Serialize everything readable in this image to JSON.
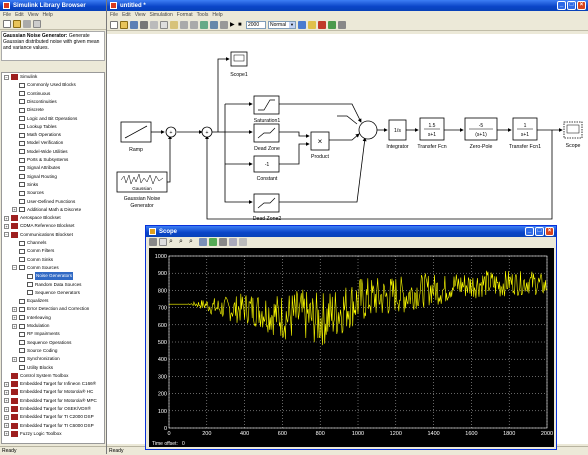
{
  "library": {
    "title": "Simulink Library Browser",
    "menu": [
      "File",
      "Edit",
      "View",
      "Help"
    ],
    "description_title": "Gaussian Noise Generator:",
    "description_text": "Generate Gaussian distributed noise with given mean and variance values.",
    "status": "Ready",
    "tree": [
      {
        "label": "Simulink",
        "level": 0,
        "kind": "lib",
        "exp": "−"
      },
      {
        "label": "Commonly Used Blocks",
        "level": 1,
        "kind": "block"
      },
      {
        "label": "Continuous",
        "level": 1,
        "kind": "block"
      },
      {
        "label": "Discontinuities",
        "level": 1,
        "kind": "block"
      },
      {
        "label": "Discrete",
        "level": 1,
        "kind": "block"
      },
      {
        "label": "Logic and Bit Operations",
        "level": 1,
        "kind": "block"
      },
      {
        "label": "Lookup Tables",
        "level": 1,
        "kind": "block"
      },
      {
        "label": "Math Operations",
        "level": 1,
        "kind": "block"
      },
      {
        "label": "Model Verification",
        "level": 1,
        "kind": "block"
      },
      {
        "label": "Model-Wide Utilities",
        "level": 1,
        "kind": "block"
      },
      {
        "label": "Ports & Subsystems",
        "level": 1,
        "kind": "block"
      },
      {
        "label": "Signal Attributes",
        "level": 1,
        "kind": "block"
      },
      {
        "label": "Signal Routing",
        "level": 1,
        "kind": "block"
      },
      {
        "label": "Sinks",
        "level": 1,
        "kind": "block"
      },
      {
        "label": "Sources",
        "level": 1,
        "kind": "block"
      },
      {
        "label": "User-Defined Functions",
        "level": 1,
        "kind": "block"
      },
      {
        "label": "Additional Math & Discrete",
        "level": 1,
        "kind": "block",
        "exp": "+"
      },
      {
        "label": "Aerospace Blockset",
        "level": 0,
        "kind": "lib",
        "exp": "+"
      },
      {
        "label": "CDMA Reference Blockset",
        "level": 0,
        "kind": "lib",
        "exp": "+"
      },
      {
        "label": "Communications Blockset",
        "level": 0,
        "kind": "lib",
        "exp": "−"
      },
      {
        "label": "Channels",
        "level": 1,
        "kind": "block"
      },
      {
        "label": "Comm Filters",
        "level": 1,
        "kind": "block"
      },
      {
        "label": "Comm Sinks",
        "level": 1,
        "kind": "block"
      },
      {
        "label": "Comm Sources",
        "level": 1,
        "kind": "block",
        "exp": "−"
      },
      {
        "label": "Noise Generators",
        "level": 2,
        "kind": "block",
        "selected": true
      },
      {
        "label": "Random Data Sources",
        "level": 2,
        "kind": "block"
      },
      {
        "label": "Sequence Generators",
        "level": 2,
        "kind": "block"
      },
      {
        "label": "Equalizers",
        "level": 1,
        "kind": "block"
      },
      {
        "label": "Error Detection and Correction",
        "level": 1,
        "kind": "block",
        "exp": "+"
      },
      {
        "label": "Interleaving",
        "level": 1,
        "kind": "block",
        "exp": "+"
      },
      {
        "label": "Modulation",
        "level": 1,
        "kind": "block",
        "exp": "+"
      },
      {
        "label": "RF Impairments",
        "level": 1,
        "kind": "block"
      },
      {
        "label": "Sequence Operations",
        "level": 1,
        "kind": "block"
      },
      {
        "label": "Source Coding",
        "level": 1,
        "kind": "block"
      },
      {
        "label": "Synchronization",
        "level": 1,
        "kind": "block",
        "exp": "+"
      },
      {
        "label": "Utility Blocks",
        "level": 1,
        "kind": "block"
      },
      {
        "label": "Control System Toolbox",
        "level": 0,
        "kind": "lib"
      },
      {
        "label": "Embedded Target for Infineon C166®",
        "level": 0,
        "kind": "lib",
        "exp": "+"
      },
      {
        "label": "Embedded Target for Motorola® HC",
        "level": 0,
        "kind": "lib",
        "exp": "+"
      },
      {
        "label": "Embedded Target for Motorola® MPC",
        "level": 0,
        "kind": "lib",
        "exp": "+"
      },
      {
        "label": "Embedded Target for OSEK/VDX®",
        "level": 0,
        "kind": "lib",
        "exp": "+"
      },
      {
        "label": "Embedded Target for TI C2000 DSP",
        "level": 0,
        "kind": "lib",
        "exp": "+"
      },
      {
        "label": "Embedded Target for TI C6000 DSP",
        "level": 0,
        "kind": "lib",
        "exp": "+"
      },
      {
        "label": "Fuzzy Logic Toolbox",
        "level": 0,
        "kind": "lib",
        "exp": "+"
      }
    ]
  },
  "model": {
    "title": "untitled *",
    "menu": [
      "File",
      "Edit",
      "View",
      "Simulation",
      "Format",
      "Tools",
      "Help"
    ],
    "stop_time": "2000",
    "sim_mode": "Normal",
    "status": "Ready",
    "blocks": {
      "scope1": "Scope1",
      "saturation1": "Saturation1",
      "ramp": "Ramp",
      "dead_zone": "Dead Zone",
      "product": "Product",
      "integrator": "Integrator",
      "integrator_text": "1/s",
      "tf1_label": "Transfer Fcn",
      "tf1_num": "1.5",
      "tf1_den": "s+1",
      "zp_label": "Zero-Pole",
      "zp_num": "-5",
      "zp_den": "(s+1)",
      "tf2_label": "Transfer Fcn1",
      "tf2_num": "1",
      "tf2_den": "s+1",
      "scope": "Scope",
      "gaussian": "Gaussian",
      "gaussian_label": "Gaussian Noise\nGenerator",
      "constant_value": "-1",
      "constant": "Constant",
      "dead_zone2": "Dead Zone2"
    }
  },
  "scope": {
    "title": "Scope",
    "time_offset_label": "Time offset:",
    "time_offset_value": "0",
    "colors": {
      "background": "#000000",
      "trace": "#ffff00",
      "grid": "#ffffff",
      "ticks": "#ffffff"
    }
  },
  "chart_data": {
    "type": "line",
    "title": "",
    "xlabel": "",
    "ylabel": "",
    "xlim": [
      0,
      2000
    ],
    "ylim": [
      0,
      1000
    ],
    "xticks": [
      0,
      200,
      400,
      600,
      800,
      1000,
      1200,
      1400,
      1600,
      1800,
      2000
    ],
    "yticks": [
      0,
      100,
      200,
      300,
      400,
      500,
      600,
      700,
      800,
      900,
      1000
    ],
    "grid": true,
    "series": [
      {
        "name": "",
        "color": "#ffff00",
        "x": [
          0,
          100,
          150,
          200,
          250,
          300,
          350,
          400,
          450,
          500,
          550,
          600,
          650,
          700,
          750,
          800,
          850,
          900,
          950,
          1000,
          1050,
          1100,
          1150,
          1200,
          1250,
          1300,
          1350,
          1400,
          1450,
          1500,
          1550,
          1600,
          1650,
          1700,
          1750,
          1800,
          1850,
          1900,
          1950,
          2000
        ],
        "mean": [
          720,
          720,
          720,
          715,
          700,
          695,
          690,
          700,
          690,
          680,
          660,
          650,
          650,
          660,
          640,
          630,
          650,
          680,
          710,
          740,
          750,
          760,
          760,
          780,
          770,
          790,
          800,
          810,
          800,
          830,
          830,
          830,
          840,
          840,
          830,
          850,
          840,
          850,
          840,
          820
        ],
        "spread": [
          0,
          0,
          20,
          40,
          60,
          70,
          80,
          90,
          100,
          110,
          120,
          140,
          150,
          150,
          150,
          160,
          160,
          150,
          140,
          140,
          130,
          120,
          120,
          110,
          110,
          100,
          100,
          90,
          90,
          80,
          80,
          80,
          80,
          80,
          80,
          70,
          70,
          70,
          70,
          60
        ]
      }
    ]
  }
}
